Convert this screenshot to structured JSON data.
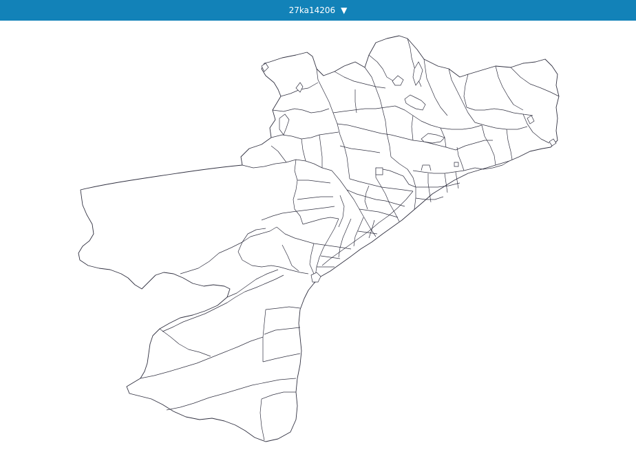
{
  "header": {
    "title": "27ka14206",
    "dropdown_icon": "caret-down-icon",
    "color": "#1282b8"
  },
  "map": {
    "type": "district-boundary-map",
    "stroke_color": "#2f2f3f",
    "fill_color": "#ffffff"
  }
}
